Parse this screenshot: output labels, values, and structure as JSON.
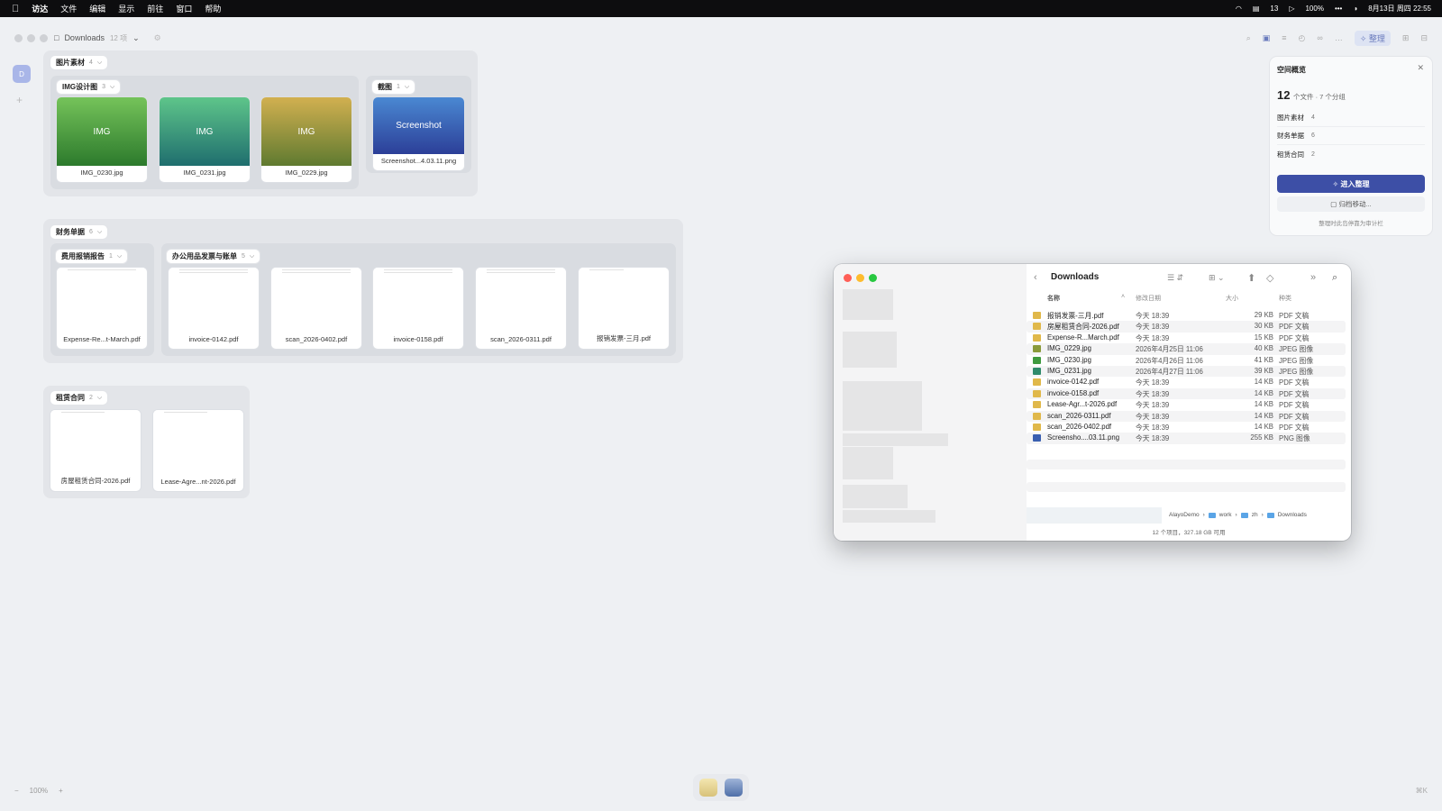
{
  "menubar": {
    "app": "访达",
    "items": [
      "文件",
      "编辑",
      "显示",
      "前往",
      "窗口",
      "帮助"
    ],
    "status": {
      "battery": "100%",
      "clock": "8月13日 周四 22:55",
      "cal": "13"
    }
  },
  "window": {
    "title": "Downloads",
    "count": "12 项"
  },
  "toolbar": {
    "organize": "整理"
  },
  "sidebar": {
    "badge": "D",
    "add": "+"
  },
  "groups": [
    {
      "label": "图片素材",
      "count": "4",
      "subs": [
        {
          "label": "IMG设计图",
          "count": "3",
          "files": [
            {
              "name": "IMG_0230.jpg",
              "thumb": "IMG",
              "c1": "#75c35a",
              "c2": "#2c7a2c"
            },
            {
              "name": "IMG_0231.jpg",
              "thumb": "IMG",
              "c1": "#5ec58a",
              "c2": "#1f6e6e"
            },
            {
              "name": "IMG_0229.jpg",
              "thumb": "IMG",
              "c1": "#d2b050",
              "c2": "#5f7a30"
            }
          ]
        },
        {
          "label": "截图",
          "count": "1",
          "files": [
            {
              "name": "Screenshot...4.03.11.png",
              "thumb": "Screenshot",
              "c1": "#4a88d2",
              "c2": "#2c3f98"
            }
          ]
        }
      ]
    },
    {
      "label": "财务单据",
      "count": "6",
      "subs": [
        {
          "label": "费用报销报告",
          "count": "1",
          "files": [
            {
              "name": "Expense-Re...t-March.pdf"
            }
          ]
        },
        {
          "label": "办公用品发票与账单",
          "count": "5",
          "files": [
            {
              "name": "invoice-0142.pdf"
            },
            {
              "name": "scan_2026-0402.pdf"
            },
            {
              "name": "invoice-0158.pdf"
            },
            {
              "name": "scan_2026-0311.pdf"
            },
            {
              "name": "报销发票-三月.pdf"
            }
          ]
        }
      ]
    },
    {
      "label": "租赁合同",
      "count": "2",
      "files": [
        {
          "name": "房屋租赁合同-2026.pdf"
        },
        {
          "name": "Lease-Agre...nt-2026.pdf"
        }
      ]
    }
  ],
  "panel": {
    "title": "空间概览",
    "total": "12",
    "summary": "个文件 · 7 个分组",
    "rows": [
      {
        "label": "图片素材",
        "value": "4"
      },
      {
        "label": "财务单据",
        "value": "6"
      },
      {
        "label": "租赁合同",
        "value": "2"
      }
    ],
    "enter": "进入整理",
    "archive": "归档移动...",
    "tip": "整理时此岛停靠为审计栏"
  },
  "finder": {
    "title": "Downloads",
    "columns": {
      "name": "名称",
      "date": "修改日期",
      "size": "大小",
      "kind": "种类"
    },
    "files": [
      {
        "name": "报销发票-三月.pdf",
        "date": "今天 18:39",
        "size": "29 KB",
        "kind": "PDF 文稿",
        "color": "#e0b84a"
      },
      {
        "name": "房屋租赁合同-2026.pdf",
        "date": "今天 18:39",
        "size": "30 KB",
        "kind": "PDF 文稿",
        "color": "#e0b84a"
      },
      {
        "name": "Expense-R...March.pdf",
        "date": "今天 18:39",
        "size": "15 KB",
        "kind": "PDF 文稿",
        "color": "#e0b84a"
      },
      {
        "name": "IMG_0229.jpg",
        "date": "2026年4月25日 11:06",
        "size": "40 KB",
        "kind": "JPEG 图像",
        "color": "#8a9a3a"
      },
      {
        "name": "IMG_0230.jpg",
        "date": "2026年4月26日 11:06",
        "size": "41 KB",
        "kind": "JPEG 图像",
        "color": "#3f9a3f"
      },
      {
        "name": "IMG_0231.jpg",
        "date": "2026年4月27日 11:06",
        "size": "39 KB",
        "kind": "JPEG 图像",
        "color": "#2f8a6a"
      },
      {
        "name": "invoice-0142.pdf",
        "date": "今天 18:39",
        "size": "14 KB",
        "kind": "PDF 文稿",
        "color": "#e0b84a"
      },
      {
        "name": "invoice-0158.pdf",
        "date": "今天 18:39",
        "size": "14 KB",
        "kind": "PDF 文稿",
        "color": "#e0b84a"
      },
      {
        "name": "Lease-Agr...t-2026.pdf",
        "date": "今天 18:39",
        "size": "14 KB",
        "kind": "PDF 文稿",
        "color": "#e0b84a"
      },
      {
        "name": "scan_2026-0311.pdf",
        "date": "今天 18:39",
        "size": "14 KB",
        "kind": "PDF 文稿",
        "color": "#e0b84a"
      },
      {
        "name": "scan_2026-0402.pdf",
        "date": "今天 18:39",
        "size": "14 KB",
        "kind": "PDF 文稿",
        "color": "#e0b84a"
      },
      {
        "name": "Screensho....03.11.png",
        "date": "今天 18:39",
        "size": "255 KB",
        "kind": "PNG 图像",
        "color": "#3a5fb0"
      }
    ],
    "path": [
      "AlayoDemo",
      "work",
      "zh",
      "Downloads"
    ],
    "status": "12 个项目，327.18 GB 可用"
  },
  "zoom": "100%",
  "bottomright": "⌘K"
}
